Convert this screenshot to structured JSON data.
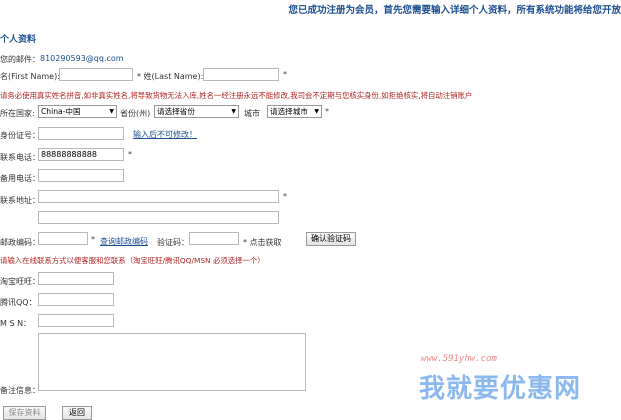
{
  "banner": "您已成功注册为会员，首先您需要输入详细个人资料，所有系统功能将给您开放",
  "section_title": "个人资料",
  "email": {
    "label": "您的邮件：",
    "value": "810290593@qq.com"
  },
  "name": {
    "first_label": "名(First Name):",
    "last_label": "* 姓(Last Name):",
    "required": "*"
  },
  "name_warning": "请务必使用真实姓名拼音,如非真实姓名,将导致货物无法入库,姓名一经注册永远不能修改,我司会不定期与您核实身份,如拒绝核实,将自动注销账户",
  "location": {
    "country_label": "所在国家:",
    "country_value": "China-中国",
    "province_label": "省份(州)",
    "province_value": "请选择省份",
    "city_label": "城市",
    "city_value": "请选择城市",
    "required": "*"
  },
  "id_card": {
    "label": "身份证号：",
    "note": "输入后不可修改！"
  },
  "phone": {
    "label": "联系电话：",
    "value": "88888888888",
    "required": "*"
  },
  "alt_phone": {
    "label": "备用电话："
  },
  "address": {
    "label": "联系地址：",
    "required": "*"
  },
  "postal": {
    "label": "邮政编码：",
    "required": "*",
    "lookup_link": "查询邮政编码",
    "captcha_label": "验证码：",
    "captcha_hint": "* 点击获取",
    "captcha_button": "确认验证码"
  },
  "contact_warning": "请输入在线联系方式以便客服和您联系（淘宝旺旺/腾讯QQ/MSN 必须选择一个）",
  "taobao": {
    "label": "淘宝旺旺："
  },
  "qq": {
    "label": "腾讯QQ："
  },
  "msn": {
    "label": "M S N："
  },
  "remarks": {
    "label": "备注信息："
  },
  "buttons": {
    "save": "保存资料",
    "back": "返回"
  },
  "watermark": {
    "url": "www.591yhw.com",
    "text": "我就要优惠网"
  }
}
